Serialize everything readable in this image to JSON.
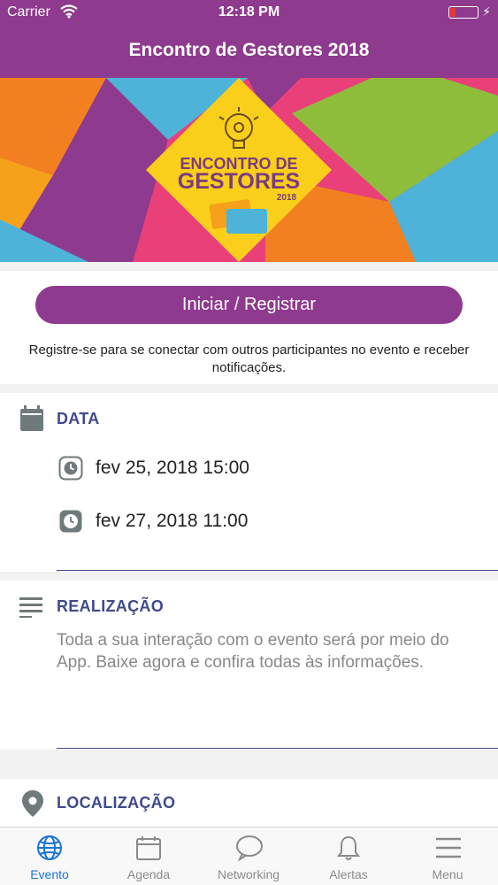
{
  "status_bar": {
    "carrier": "Carrier",
    "time": "12:18 PM",
    "battery_level": 0.2
  },
  "header": {
    "title": "Encontro de Gestores 2018"
  },
  "banner": {
    "line1": "ENCONTRO DE",
    "line2": "GESTORES",
    "year": "2018"
  },
  "register": {
    "button_label": "Iniciar / Registrar",
    "description": "Registre-se para se conectar com outros participantes no evento e receber notificações."
  },
  "sections": {
    "data": {
      "title": "DATA",
      "dates": [
        "fev 25, 2018 15:00",
        "fev 27, 2018 11:00"
      ]
    },
    "realizacao": {
      "title": "REALIZAÇÃO",
      "text": "Toda a sua interação com o evento será por meio do App. Baixe agora e confira todas às informações."
    },
    "localizacao": {
      "title": "LOCALIZAÇÃO"
    }
  },
  "tabs": [
    {
      "label": "Evento",
      "icon": "globe-icon",
      "active": true
    },
    {
      "label": "Agenda",
      "icon": "calendar-icon",
      "active": false
    },
    {
      "label": "Networking",
      "icon": "chat-bubble-icon",
      "active": false
    },
    {
      "label": "Alertas",
      "icon": "bell-icon",
      "active": false
    },
    {
      "label": "Menu",
      "icon": "hamburger-menu-icon",
      "active": false
    }
  ],
  "colors": {
    "brand_purple": "#8e3a8e",
    "section_title": "#3f4a8c",
    "active_tab": "#1a73d8"
  }
}
